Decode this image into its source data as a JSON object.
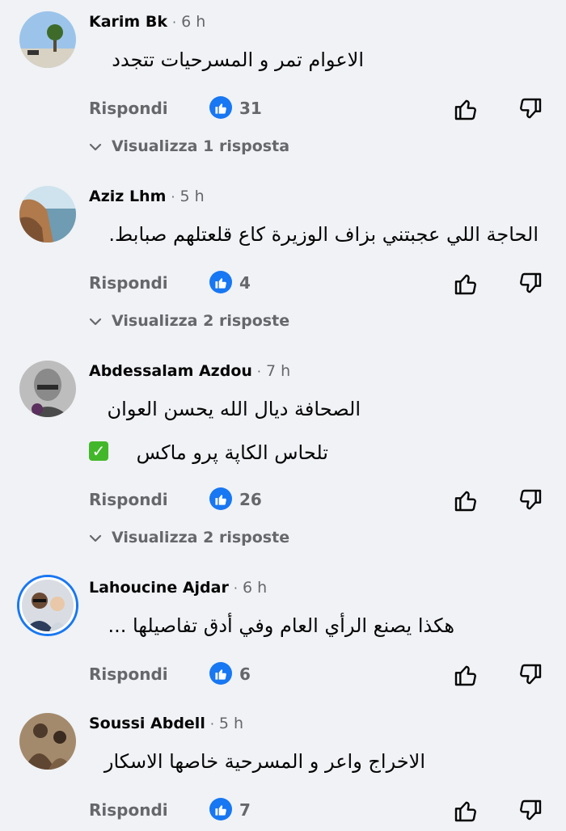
{
  "comments": [
    {
      "author": "Karim Bk",
      "time": "6 h",
      "lines": [
        "الاعوام تمر و المسرحيات تتجدد"
      ],
      "reply_label": "Rispondi",
      "likes": "31",
      "view_replies": "Visualizza 1 risposta"
    },
    {
      "author": "Aziz Lhm",
      "time": "5 h",
      "lines": [
        "الحاجة اللي عجبتني بزاف الوزيرة كاع قلعتلهم صبابط."
      ],
      "reply_label": "Rispondi",
      "likes": "4",
      "view_replies": "Visualizza 2 risposte"
    },
    {
      "author": "Abdessalam Azdou",
      "time": "7 h",
      "lines": [
        "الصحافة ديال الله يحسن العوان",
        "تلحاس الكاپة پرو ماكس"
      ],
      "reply_label": "Rispondi",
      "likes": "26",
      "view_replies": "Visualizza 2 risposte"
    },
    {
      "author": "Lahoucine Ajdar",
      "time": "6 h",
      "lines": [
        "هكذا يصنع الرأي العام وفي أدق تفاصيلها ..."
      ],
      "reply_label": "Rispondi",
      "likes": "6"
    },
    {
      "author": "Soussi Abdell",
      "time": "5 h",
      "lines": [
        "الاخراج واعر و المسرحية خاصها الاسكار"
      ],
      "reply_label": "Rispondi",
      "likes": "7"
    }
  ],
  "colors": {
    "accent": "#1877f2",
    "muted": "#65676b",
    "background": "#f0f2f5",
    "check": "#42b72a"
  },
  "icons": [
    "like-reaction-icon",
    "thumbs-up-icon",
    "thumbs-down-icon",
    "chevron-down-icon",
    "check-mark-emoji"
  ]
}
